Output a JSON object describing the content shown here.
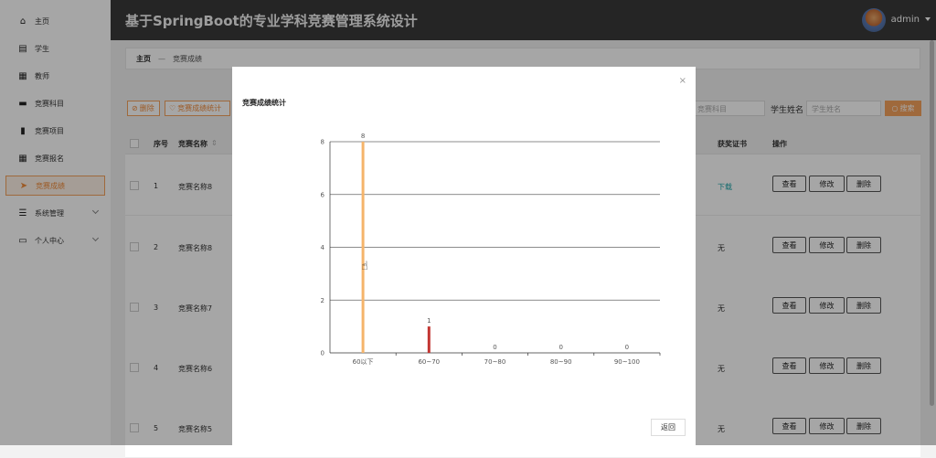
{
  "app": {
    "title": "基于SpringBoot的专业学科竞赛管理系统设计",
    "user": "admin"
  },
  "sidebar": {
    "items": [
      {
        "label": "主页",
        "icon": "home-icon",
        "glyph": "⌂"
      },
      {
        "label": "学生",
        "icon": "clipboard-icon",
        "glyph": "▤"
      },
      {
        "label": "教师",
        "icon": "grid-icon",
        "glyph": "▦"
      },
      {
        "label": "竞赛科目",
        "icon": "message-icon",
        "glyph": "▬"
      },
      {
        "label": "竞赛项目",
        "icon": "bar-chart-icon",
        "glyph": "▮"
      },
      {
        "label": "竞赛报名",
        "icon": "grid-icon",
        "glyph": "▦"
      },
      {
        "label": "竞赛成绩",
        "icon": "send-icon",
        "glyph": "➤"
      },
      {
        "label": "系统管理",
        "icon": "sliders-icon",
        "glyph": "☰"
      },
      {
        "label": "个人中心",
        "icon": "id-card-icon",
        "glyph": "▭"
      }
    ]
  },
  "breadcrumb": {
    "home": "主页",
    "sep": "—",
    "current": "竞赛成绩"
  },
  "toolbar": {
    "delete": "删除",
    "stats": "竞赛成绩统计"
  },
  "search": {
    "subject_placeholder": "竞赛科目",
    "name_label": "学生姓名",
    "name_placeholder": "学生姓名",
    "button": "搜索"
  },
  "table": {
    "headers": {
      "index": "序号",
      "name": "竞赛名称",
      "cert": "获奖证书",
      "ops": "操作"
    },
    "rows": [
      {
        "index": "1",
        "name": "竞赛名称8",
        "cert": "下载"
      },
      {
        "index": "2",
        "name": "竞赛名称8",
        "cert": "无"
      },
      {
        "index": "3",
        "name": "竞赛名称7",
        "cert": "无"
      },
      {
        "index": "4",
        "name": "竞赛名称6",
        "cert": "无"
      },
      {
        "index": "5",
        "name": "竞赛名称5",
        "cert": "无"
      }
    ],
    "actions": {
      "view": "查看",
      "edit": "修改",
      "delete": "删除"
    }
  },
  "modal": {
    "title": "竞赛成绩统计",
    "close": "×",
    "back": "返回"
  },
  "chart_data": {
    "type": "bar",
    "categories": [
      "60以下",
      "60~70",
      "70~80",
      "80~90",
      "90~100"
    ],
    "values": [
      8,
      1,
      0,
      0,
      0
    ],
    "ylim": [
      0,
      8
    ],
    "yticks": [
      0,
      2,
      4,
      6,
      8
    ],
    "grid": true,
    "colors": [
      "#f5b46a",
      "#c23531",
      "#c23531",
      "#c23531",
      "#c23531"
    ]
  }
}
